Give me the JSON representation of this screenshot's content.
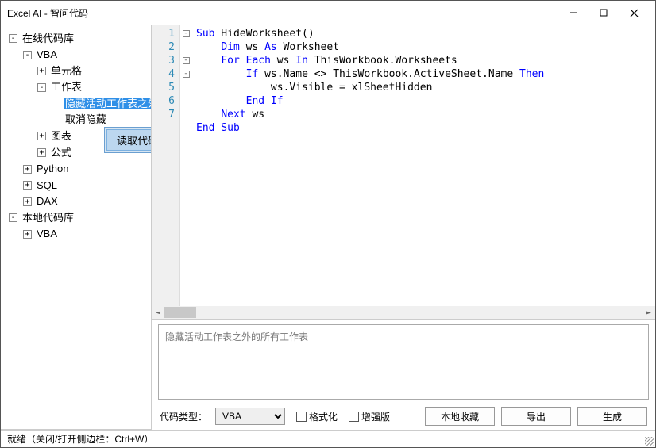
{
  "window": {
    "title": "Excel AI - 智问代码"
  },
  "tree": {
    "root1": "在线代码库",
    "vba": "VBA",
    "cell": "单元格",
    "sheet": "工作表",
    "item_hide": "隐藏活动工作表之外",
    "item_unhide": "取消隐藏",
    "chart": "图表",
    "formula": "公式",
    "python": "Python",
    "sql": "SQL",
    "dax": "DAX",
    "root2": "本地代码库",
    "local_vba": "VBA"
  },
  "contextmenu": {
    "read": "读取代码"
  },
  "code": {
    "lines": [
      "1",
      "2",
      "3",
      "4",
      "5",
      "6",
      "7"
    ],
    "l1a": "Sub",
    "l1b": " HideWorksheet()",
    "l2a": "Dim",
    "l2b": " ws ",
    "l2c": "As",
    "l2d": " Worksheet",
    "l3a": "For Each",
    "l3b": " ws ",
    "l3c": "In",
    "l3d": " ThisWorkbook.Worksheets",
    "l4a": "If",
    "l4b": " ws.Name <> ThisWorkbook.ActiveSheet.Name ",
    "l4c": "Then",
    "l5": "ws.Visible = xlSheetHidden",
    "l6": "End If",
    "l7a": "Next",
    "l7b": " ws",
    "l8": "End Sub"
  },
  "description": "隐藏活动工作表之外的所有工作表",
  "bottom": {
    "type_label": "代码类型：",
    "type_value": "VBA",
    "format": "格式化",
    "enhance": "增强版",
    "fav": "本地收藏",
    "export": "导出",
    "generate": "生成"
  },
  "status": "就绪（关闭/打开侧边栏：Ctrl+W）"
}
